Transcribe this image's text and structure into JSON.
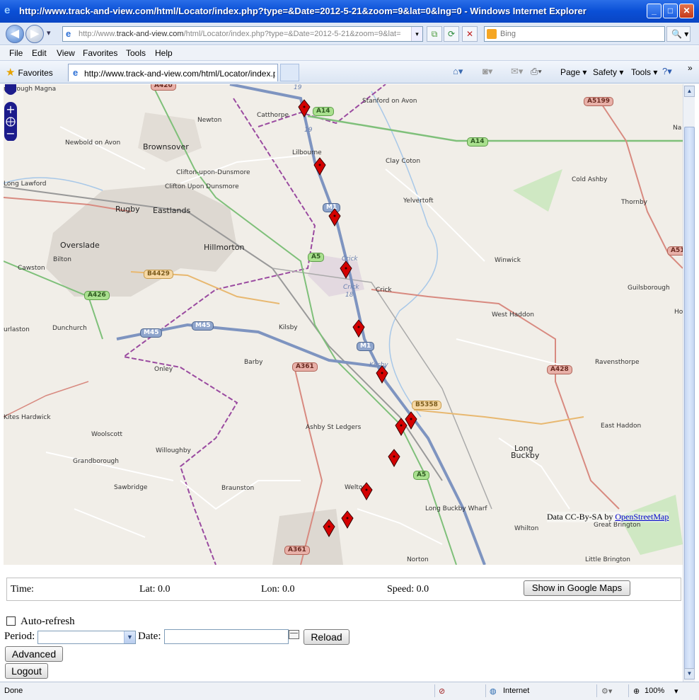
{
  "window": {
    "title": "http://www.track-and-view.com/html/Locator/index.php?type=&Date=2012-5-21&zoom=9&lat=0&lng=0 - Windows Internet Explorer",
    "app_icon": "e",
    "minimize": "_",
    "maximize": "□",
    "close": "✕"
  },
  "nav": {
    "back": "◀",
    "forward": "▶",
    "history": "▾"
  },
  "address": {
    "url_prefix": "http://www.",
    "url_host": "track-and-view.com",
    "url_rest": "/html/Locator/index.php?type=&Date=2012-5-21&zoom=9&lat=",
    "dropdown": "▾"
  },
  "search": {
    "placeholder": "Bing",
    "go": "🔍 ▾"
  },
  "toolbar_icons": {
    "compat": "⧉",
    "refresh": "⟳",
    "stop": "✕"
  },
  "menu": [
    "File",
    "Edit",
    "View",
    "Favorites",
    "Tools",
    "Help"
  ],
  "favorites": {
    "label": "Favorites",
    "star": "★"
  },
  "tab": {
    "label": "http://www.track-and-view.com/html/Locator/index.p...",
    "icon": "e"
  },
  "commands": {
    "home": "⌂▾",
    "feeds": "◙▾",
    "mail": "✉▾",
    "print": "⎙▾",
    "page": "Page ▾",
    "safety": "Safety ▾",
    "tools": "Tools ▾",
    "help": "?▾",
    "more": "»"
  },
  "map": {
    "places": [
      {
        "name": "Newton"
      },
      {
        "name": "Catthorpe"
      },
      {
        "name": "Stanford on Avon"
      },
      {
        "name": "Newbold on Avon"
      },
      {
        "name": "Brownsover"
      },
      {
        "name": "Lilbourne"
      },
      {
        "name": "Clay Coton"
      },
      {
        "name": "Clifton-upon-Dunsmore"
      },
      {
        "name": "Clifton Upon Dunsmore"
      },
      {
        "name": "Long Lawford"
      },
      {
        "name": "Cold Ashby"
      },
      {
        "name": "Thornby"
      },
      {
        "name": "Yelvertoft"
      },
      {
        "name": "Rugby"
      },
      {
        "name": "Eastlands"
      },
      {
        "name": "Overslade"
      },
      {
        "name": "Hillmorton"
      },
      {
        "name": "Cawston"
      },
      {
        "name": "Bilton"
      },
      {
        "name": "Winwick"
      },
      {
        "name": "Crick"
      },
      {
        "name": "Guilsborough"
      },
      {
        "name": "West Haddon"
      },
      {
        "name": "Dunchurch"
      },
      {
        "name": "Kilsby"
      },
      {
        "name": "Onley"
      },
      {
        "name": "Barby"
      },
      {
        "name": "Ravensthorpe"
      },
      {
        "name": "Kites Hardwick"
      },
      {
        "name": "Ashby St Ledgers"
      },
      {
        "name": "East Haddon"
      },
      {
        "name": "Woolscott"
      },
      {
        "name": "Willoughby"
      },
      {
        "name": "Long"
      },
      {
        "name": "Buckby"
      },
      {
        "name": "Grandborough"
      },
      {
        "name": "Sawbridge"
      },
      {
        "name": "Braunston"
      },
      {
        "name": "Welton"
      },
      {
        "name": "Long Buckby Wharf"
      },
      {
        "name": "Whilton"
      },
      {
        "name": "Great Brington"
      },
      {
        "name": "Norton"
      },
      {
        "name": "Little Brington"
      },
      {
        "name": "rborough Magna"
      },
      {
        "name": "urlaston"
      },
      {
        "name": "Na"
      },
      {
        "name": "Ho"
      }
    ],
    "roads": [
      {
        "label": "A14"
      },
      {
        "label": "A14"
      },
      {
        "label": "A5199"
      },
      {
        "label": "M1"
      },
      {
        "label": "A5"
      },
      {
        "label": "B4429"
      },
      {
        "label": "A426"
      },
      {
        "label": "M45"
      },
      {
        "label": "M45"
      },
      {
        "label": "M1"
      },
      {
        "label": "A361"
      },
      {
        "label": "A428"
      },
      {
        "label": "B5358"
      },
      {
        "label": "A5"
      },
      {
        "label": "A361"
      },
      {
        "label": "A51"
      },
      {
        "label": "A420"
      }
    ],
    "junctions": [
      "Crick",
      "Crick",
      "18",
      "19",
      "19",
      "Kilsby"
    ],
    "attribution_prefix": "Data CC-By-SA by ",
    "attribution_link": "OpenStreetMap",
    "marker_count": 12
  },
  "info": {
    "time_label": "Time:",
    "lat_label": "Lat: 0.0",
    "lon_label": "Lon: 0.0",
    "speed_label": "Speed: 0.0",
    "google_button": "Show in Google Maps"
  },
  "controls": {
    "auto_refresh": "Auto-refresh",
    "period_label": "Period:",
    "period_value": "",
    "date_label": "Date:",
    "date_value": "",
    "reload": "Reload",
    "advanced": "Advanced",
    "logout": "Logout"
  },
  "status": {
    "text": "Done",
    "zone": "Internet",
    "zoom": "100%"
  }
}
